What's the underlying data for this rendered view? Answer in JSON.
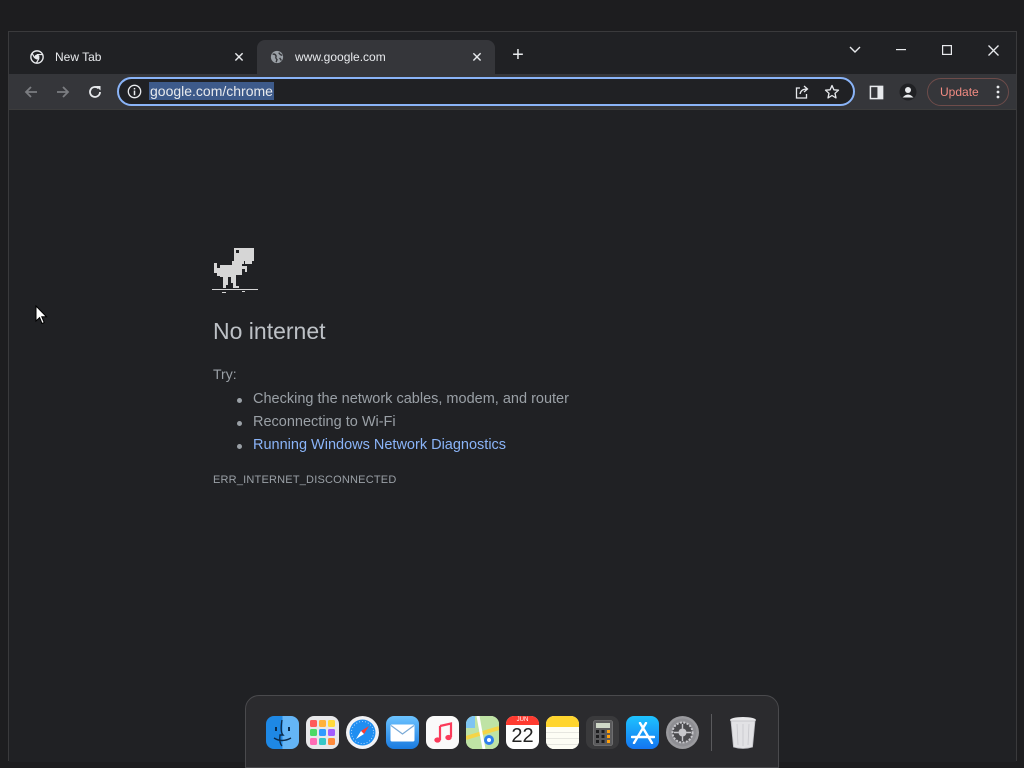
{
  "browser": {
    "tabs": [
      {
        "title": "New Tab",
        "active": false,
        "icon": "chrome-icon"
      },
      {
        "title": "www.google.com",
        "active": true,
        "icon": "globe-icon"
      }
    ],
    "new_tab_label": "+",
    "address_bar": {
      "url": "google.com/chrome",
      "selected": true
    },
    "update_button_label": "Update"
  },
  "error_page": {
    "headline": "No internet",
    "try_label": "Try:",
    "suggestions": [
      "Checking the network cables, modem, and router",
      "Reconnecting to Wi-Fi",
      "Running Windows Network Diagnostics"
    ],
    "error_code": "ERR_INTERNET_DISCONNECTED"
  },
  "dock": {
    "apps": [
      "finder-icon",
      "launchpad-icon",
      "safari-icon",
      "mail-icon",
      "music-icon",
      "maps-icon",
      "calendar-icon",
      "notes-icon",
      "calculator-icon",
      "app-store-icon",
      "system-settings-icon"
    ],
    "calendar": {
      "month": "JUN",
      "day": "22"
    },
    "trash": "trash-icon"
  },
  "colors": {
    "accent": "#8ab4f8",
    "update": "#f28b82",
    "page_background": "#202124"
  }
}
